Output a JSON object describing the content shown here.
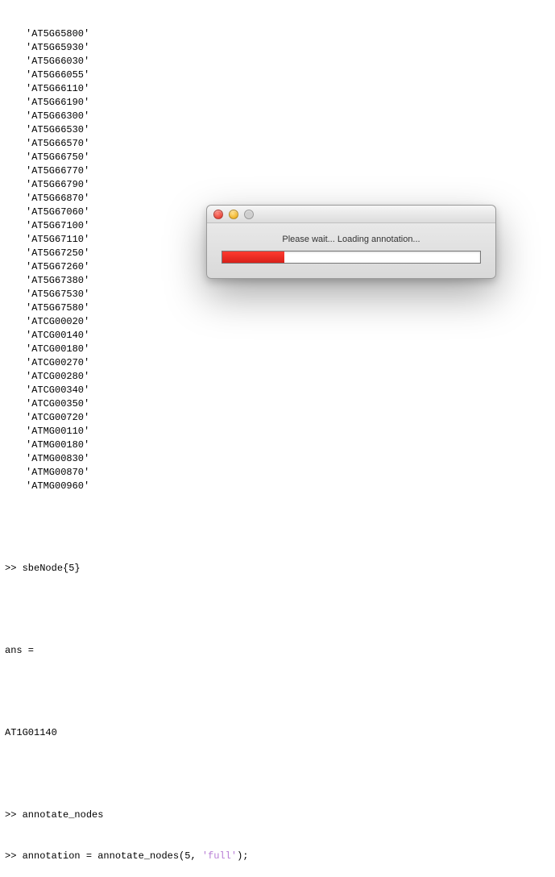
{
  "console": {
    "gene_list": [
      "'AT5G65800'",
      "'AT5G65930'",
      "'AT5G66030'",
      "'AT5G66055'",
      "'AT5G66110'",
      "'AT5G66190'",
      "'AT5G66300'",
      "'AT5G66530'",
      "'AT5G66570'",
      "'AT5G66750'",
      "'AT5G66770'",
      "'AT5G66790'",
      "'AT5G66870'",
      "'AT5G67060'",
      "'AT5G67100'",
      "'AT5G67110'",
      "'AT5G67250'",
      "'AT5G67260'",
      "'AT5G67380'",
      "'AT5G67530'",
      "'AT5G67580'",
      "'ATCG00020'",
      "'ATCG00140'",
      "'ATCG00180'",
      "'ATCG00270'",
      "'ATCG00280'",
      "'ATCG00340'",
      "'ATCG00350'",
      "'ATCG00720'",
      "'ATMG00110'",
      "'ATMG00180'",
      "'ATMG00830'",
      "'ATMG00870'",
      "'ATMG00960'"
    ],
    "cmd1_prefix": ">> ",
    "cmd1": "sbeNode{5}",
    "ans_label": "ans =",
    "ans_value": "AT1G01140",
    "cmd2_prefix": ">> ",
    "cmd2": "annotate_nodes",
    "cmd3_prefix": ">> ",
    "cmd3_a": "annotation = annotate_nodes(5, ",
    "cmd3_str": "'full'",
    "cmd3_b": ");"
  },
  "dialog": {
    "message": "Please wait... Loading annotation...",
    "progress_percent": 24
  }
}
